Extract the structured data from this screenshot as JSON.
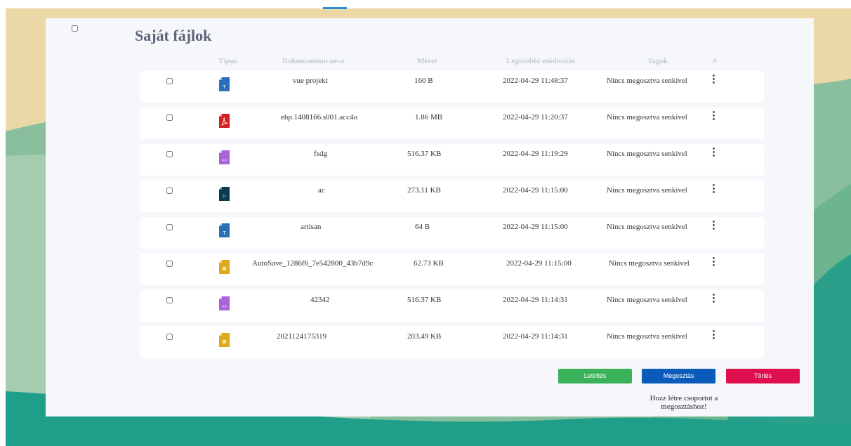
{
  "page": {
    "title": "Saját fájlok"
  },
  "table": {
    "headers": {
      "type": "Típus",
      "name": "Dokumentum neve",
      "size": "Méret",
      "modified": "Legutóbbi módosítás",
      "members": "Tagok",
      "index": "#"
    },
    "rows": [
      {
        "icon": "text-file-icon",
        "icon_color": "#2b6fb6",
        "name": "vue projekt",
        "size": "160 B",
        "modified": "2022-04-29 11:48:37",
        "members": "Nincs megosztva senkivel"
      },
      {
        "icon": "pdf-file-icon",
        "icon_color": "#d21f1f",
        "name": "ehp.1408166.s001.acc4o",
        "size": "1.86 MB",
        "modified": "2022-04-29 11:20:37",
        "members": "Nincs megosztva senkivel"
      },
      {
        "icon": "code-file-icon",
        "icon_color": "#a863d8",
        "name": "fsdg",
        "size": "516.37 KB",
        "modified": "2022-04-29 11:19:29",
        "members": "Nincs megosztva senkivel"
      },
      {
        "icon": "photoshop-file-icon",
        "icon_color": "#0b3b4c",
        "name": "ac",
        "size": "273.11 KB",
        "modified": "2022-04-29 11:15:00",
        "members": "Nincs megosztva senkivel"
      },
      {
        "icon": "text-file-icon",
        "icon_color": "#2b6fb6",
        "name": "artisan",
        "size": "64 B",
        "modified": "2022-04-29 11:15:00",
        "members": "Nincs megosztva senkivel"
      },
      {
        "icon": "archive-file-icon",
        "icon_color": "#e0a81c",
        "name": "AutoSave_1286f6_7e542800_43b7d9c",
        "size": "62.73 KB",
        "modified": "2022-04-29 11:15:00",
        "members": "Nincs megosztva senkivel"
      },
      {
        "icon": "code-file-icon",
        "icon_color": "#a863d8",
        "name": "42342",
        "size": "516.37 KB",
        "modified": "2022-04-29 11:14:31",
        "members": "Nincs megosztva senkivel"
      },
      {
        "icon": "archive-file-icon",
        "icon_color": "#e0a81c",
        "name": "2021124175319",
        "size": "203.49 KB",
        "modified": "2022-04-29 11:14:31",
        "members": "Nincs megosztva senkivel"
      }
    ]
  },
  "actions": {
    "download_label": "Letöltés",
    "share_label": "Megosztás",
    "delete_label": "Törlés",
    "share_hint": "Hozz létre csoportot a megosztáshoz!"
  },
  "colors": {
    "download": "#3bb15a",
    "share": "#0b5cba",
    "delete": "#df0f4e",
    "background_sand": "#ead8a6",
    "background_teal": "#1f9e8a"
  }
}
